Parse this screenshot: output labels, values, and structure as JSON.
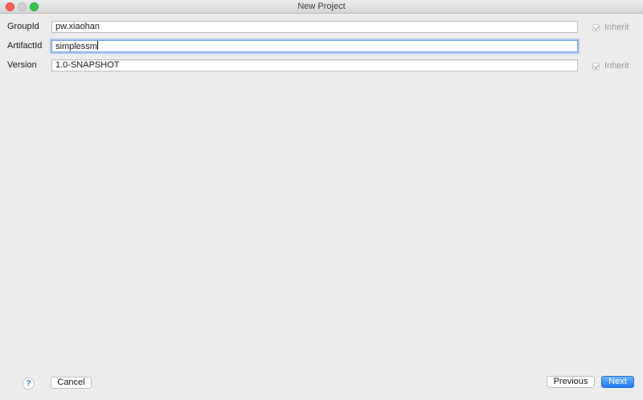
{
  "window": {
    "title": "New Project"
  },
  "form": {
    "group_id": {
      "label": "GroupId",
      "value": "pw.xiaohan",
      "inherit_label": "Inherit",
      "inherit_checked": true
    },
    "artifact_id": {
      "label": "ArtifactId",
      "value": "simplessm"
    },
    "version": {
      "label": "Version",
      "value": "1.0-SNAPSHOT",
      "inherit_label": "Inherit",
      "inherit_checked": true
    }
  },
  "footer": {
    "help_icon": "?",
    "cancel_label": "Cancel",
    "previous_label": "Previous",
    "next_label": "Next"
  },
  "colors": {
    "background": "#ececec",
    "focus_ring": "#a9c6ee",
    "primary_button": "#1d7cf3"
  }
}
